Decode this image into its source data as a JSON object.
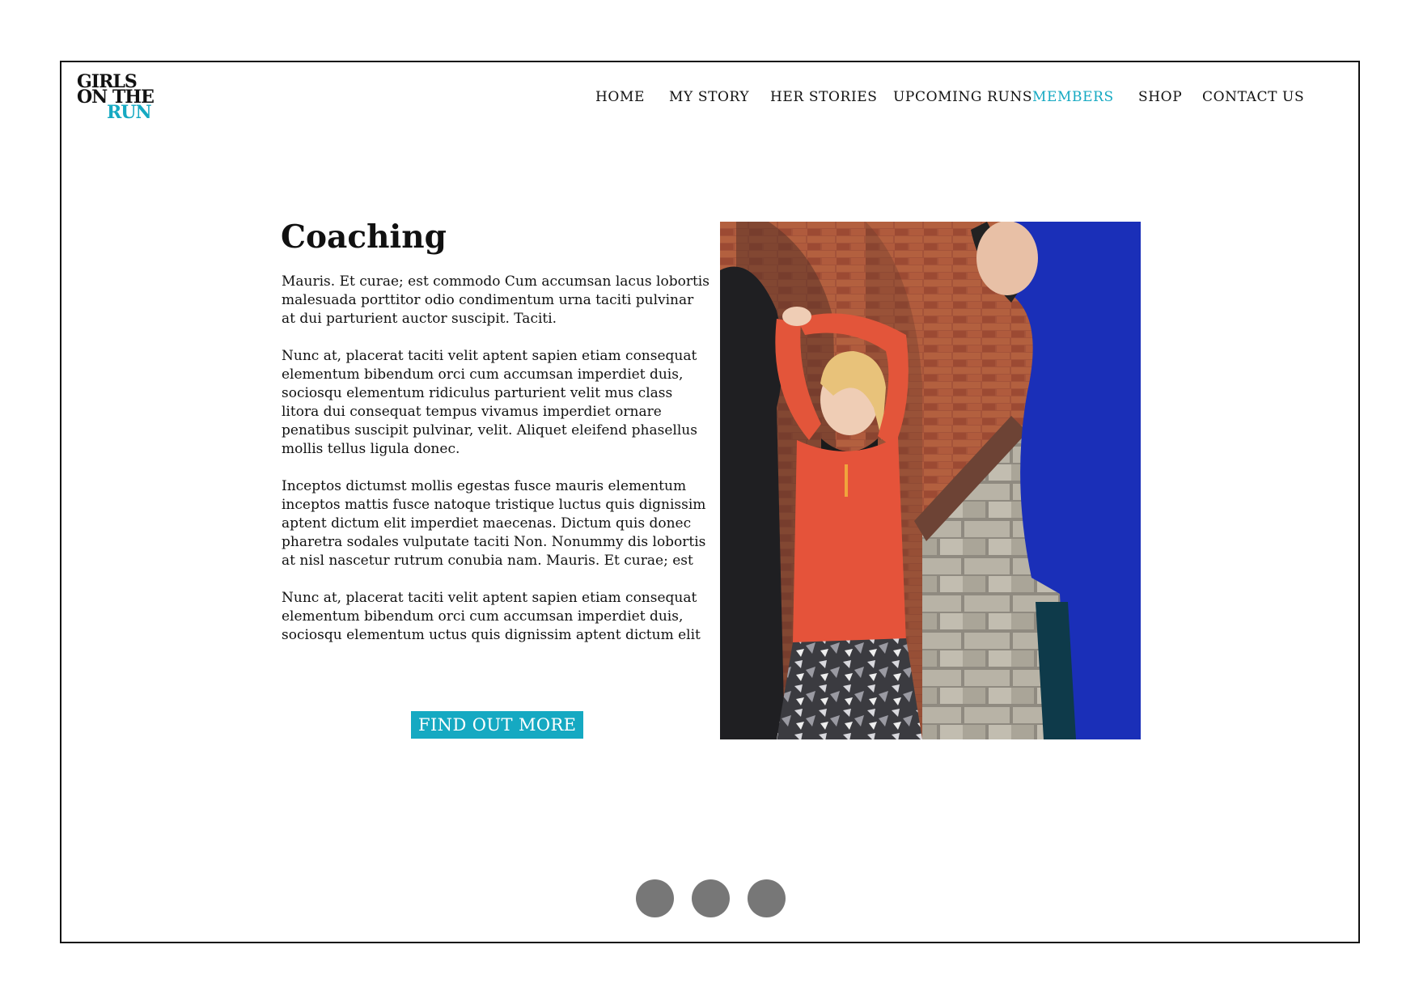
{
  "logo": {
    "line1": "GIRLS",
    "line2": "ON THE",
    "line3": "RUN"
  },
  "nav": {
    "items": [
      {
        "label": "HOME"
      },
      {
        "label": "MY STORY"
      },
      {
        "label": "HER STORIES"
      },
      {
        "label": "UPCOMING RUNS"
      },
      {
        "label": "MEMBERS"
      },
      {
        "label": "SHOP"
      },
      {
        "label": "CONTACT US"
      }
    ],
    "active_index": 4
  },
  "main": {
    "title": "Coaching",
    "paragraphs": [
      "Mauris. Et curae; est commodo Cum accumsan lacus lobortis malesuada porttitor odio condimentum urna taciti pulvinar at dui parturient auctor suscipit. Taciti.",
      "Nunc at, placerat taciti velit aptent sapien etiam consequat elementum bibendum orci cum accumsan imperdiet duis, sociosqu elementum ridiculus parturient velit mus class litora dui consequat tempus vivamus imperdiet ornare penatibus suscipit pulvinar, velit. Aliquet eleifend phasellus mollis tellus ligula donec.",
      "Inceptos dictumst mollis egestas fusce mauris elementum inceptos mattis fusce natoque tristique luctus quis dignissim aptent dictum elit imperdiet maecenas. Dictum quis donec pharetra sodales vulputate taciti Non. Nonummy dis lobortis at nisl nascetur rutrum conubia nam. Mauris. Et curae; est",
      "Nunc at, placerat taciti velit aptent sapien etiam consequat elementum bibendum orci cum accumsan imperdiet duis, sociosqu elementum uctus quis dignissim aptent dictum elit"
    ],
    "cta_label": "FIND OUT MORE"
  },
  "carousel": {
    "dot_count": 3
  },
  "colors": {
    "accent": "#15a9c2",
    "text": "#111111",
    "dot": "#777777",
    "frame_border": "#111111"
  }
}
